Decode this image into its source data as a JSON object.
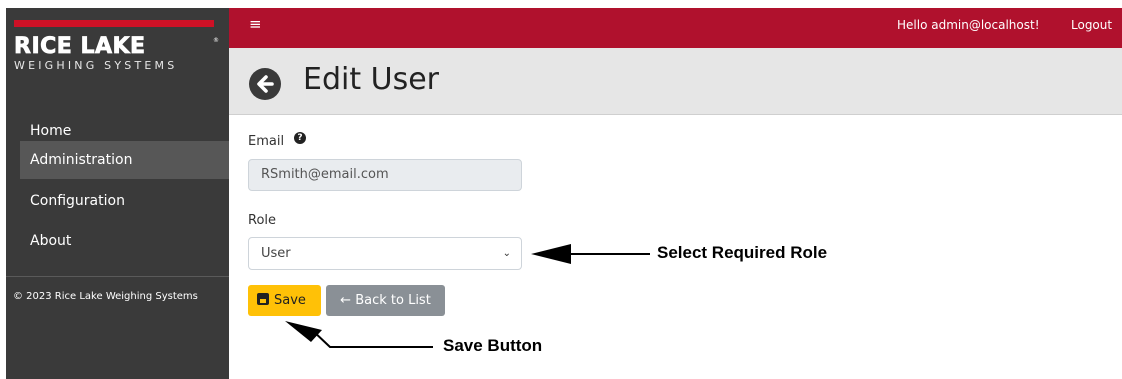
{
  "brand": {
    "name": "RICE LAKE",
    "registered_mark": "®",
    "tagline": "WEIGHING SYSTEMS",
    "accent_color": "#b0112d"
  },
  "topbar": {
    "menu_icon": "hamburger-icon",
    "greeting": "Hello admin@localhost!",
    "logout_label": "Logout"
  },
  "sidebar": {
    "items": [
      {
        "label": "Home",
        "active": false
      },
      {
        "label": "Administration",
        "active": true
      },
      {
        "label": "Configuration",
        "active": false
      },
      {
        "label": "About",
        "active": false
      }
    ],
    "footer": "© 2023 Rice Lake Weighing Systems"
  },
  "page": {
    "back_icon": "arrow-left-circle-icon",
    "title": "Edit User"
  },
  "form": {
    "email_label": "Email",
    "email_help_icon": "question-circle-icon",
    "email_value": "RSmith@email.com",
    "role_label": "Role",
    "role_value": "User",
    "save_icon": "floppy-disk-icon",
    "save_label": "Save",
    "back_label": "← Back to List"
  },
  "annotations": {
    "role_callout": "Select Required Role",
    "save_callout": "Save Button"
  }
}
